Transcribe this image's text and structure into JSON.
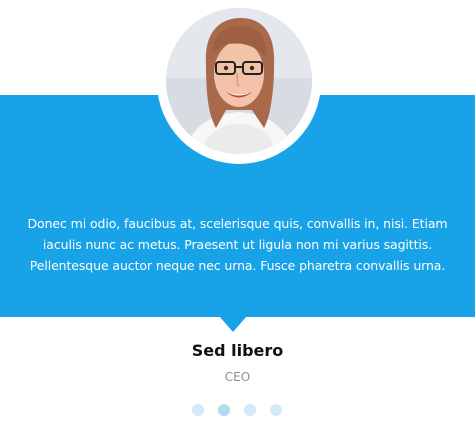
{
  "testimonial": {
    "quote": "Donec mi odio, faucibus at, scelerisque quis, convallis in, nisi. Etiam iaculis nunc ac metus. Praesent ut ligula non mi varius sagittis. Pellentesque auctor neque nec urna. Fusce pharetra convallis urna.",
    "name": "Sed libero",
    "role": "CEO"
  },
  "pagination": {
    "count": 4,
    "active_index": 1
  },
  "colors": {
    "accent": "#18a3e9",
    "dot": "#d3eaf6",
    "dot_active": "#b7d9ee"
  }
}
